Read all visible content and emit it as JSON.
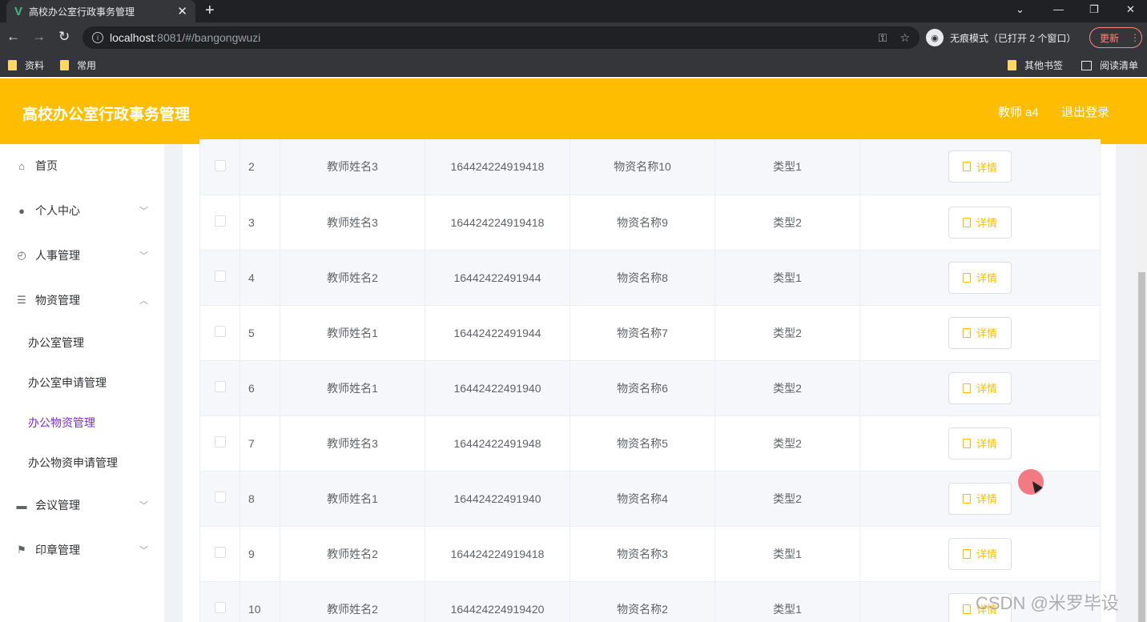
{
  "browser": {
    "tab_title": "高校办公室行政事务管理",
    "tab_logo": "V",
    "tab_close": "✕",
    "new_tab": "+",
    "url_host": "localhost",
    "url_rest": ":8081/#/bangongwuzi",
    "incognito_label": "无痕模式（已打开 2 个窗口）",
    "update_label": "更新",
    "bookmarks": [
      {
        "label": "资料"
      },
      {
        "label": "常用"
      }
    ],
    "other_bookmarks": "其他书签",
    "reading_list": "阅读清单"
  },
  "header": {
    "title": "高校办公室行政事务管理",
    "user": "教师 a4",
    "logout": "退出登录"
  },
  "sidebar": {
    "items": [
      {
        "label": "首页",
        "icon": "home-icon"
      },
      {
        "label": "个人中心",
        "icon": "user-icon"
      },
      {
        "label": "人事管理",
        "icon": "dashboard-icon"
      },
      {
        "label": "物资管理",
        "icon": "list-icon"
      },
      {
        "label": "会议管理",
        "icon": "meeting-icon"
      },
      {
        "label": "印章管理",
        "icon": "flag-icon"
      }
    ],
    "subitems": [
      {
        "label": "办公室管理"
      },
      {
        "label": "办公室申请管理"
      },
      {
        "label": "办公物资管理",
        "active": true
      },
      {
        "label": "办公物资申请管理"
      }
    ]
  },
  "table": {
    "detail_label": "详情",
    "rows": [
      {
        "index": "2",
        "teacher": "教师姓名3",
        "number": "164424224919418",
        "item": "物资名称10",
        "type": "类型1"
      },
      {
        "index": "3",
        "teacher": "教师姓名3",
        "number": "164424224919418",
        "item": "物资名称9",
        "type": "类型2"
      },
      {
        "index": "4",
        "teacher": "教师姓名2",
        "number": "16442422491944",
        "item": "物资名称8",
        "type": "类型1"
      },
      {
        "index": "5",
        "teacher": "教师姓名1",
        "number": "16442422491944",
        "item": "物资名称7",
        "type": "类型2"
      },
      {
        "index": "6",
        "teacher": "教师姓名1",
        "number": "16442422491940",
        "item": "物资名称6",
        "type": "类型2"
      },
      {
        "index": "7",
        "teacher": "教师姓名3",
        "number": "16442422491948",
        "item": "物资名称5",
        "type": "类型2"
      },
      {
        "index": "8",
        "teacher": "教师姓名1",
        "number": "16442422491940",
        "item": "物资名称4",
        "type": "类型2"
      },
      {
        "index": "9",
        "teacher": "教师姓名2",
        "number": "164424224919418",
        "item": "物资名称3",
        "type": "类型1"
      },
      {
        "index": "10",
        "teacher": "教师姓名2",
        "number": "164424224919420",
        "item": "物资名称2",
        "type": "类型1"
      }
    ]
  },
  "watermark": "CSDN @米罗毕设",
  "colors": {
    "accent": "#ffbd00",
    "active_menu": "#7b2fbf"
  }
}
